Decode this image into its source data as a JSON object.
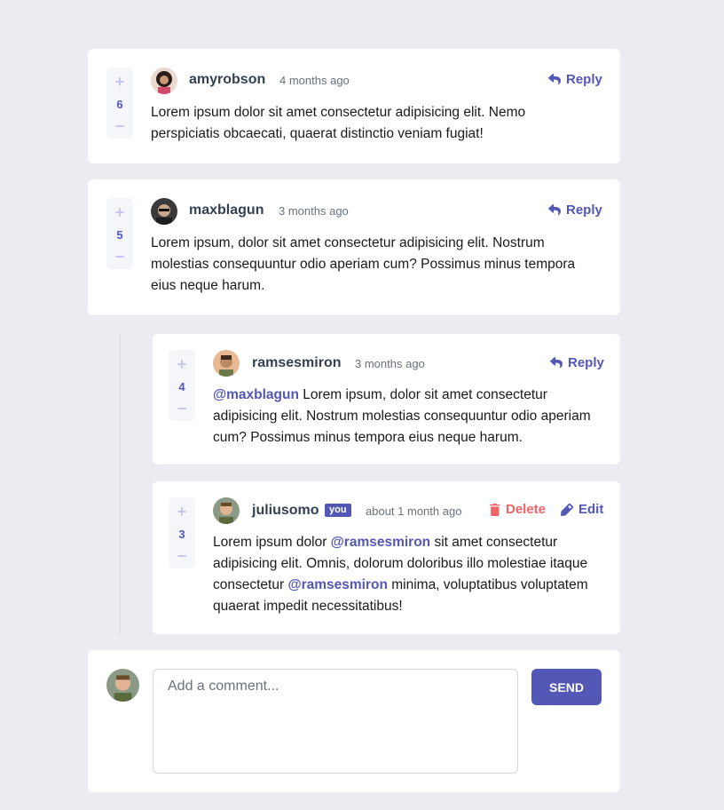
{
  "comments": [
    {
      "score": "6",
      "username": "amyrobson",
      "time": "4 months ago",
      "reply_label": "Reply",
      "content": "Lorem ipsum dolor sit amet consectetur adipisicing elit. Nemo perspiciatis obcaecati, quaerat distinctio veniam fugiat!"
    },
    {
      "score": "5",
      "username": "maxblagun",
      "time": "3 months ago",
      "reply_label": "Reply",
      "content": "Lorem ipsum, dolor sit amet consectetur adipisicing elit. Nostrum molestias consequuntur odio aperiam cum? Possimus minus tempora eius neque harum."
    }
  ],
  "replies": [
    {
      "score": "4",
      "username": "ramsesmiron",
      "time": "3 months ago",
      "reply_label": "Reply",
      "mention": "@maxblagun",
      "content": "Lorem ipsum, dolor sit amet consectetur adipisicing elit. Nostrum molestias consequuntur odio aperiam cum? Possimus minus tempora eius neque harum."
    },
    {
      "score": "3",
      "username": "juliusomo",
      "you_badge": "you",
      "time": "about 1 month ago",
      "delete_label": "Delete",
      "edit_label": "Edit",
      "content_part1": "Lorem ipsum dolor",
      "mention1": "@ramsesmiron",
      "content_part2": "sit amet consectetur adipisicing elit. Omnis, dolorum doloribus illo molestiae itaque consectetur",
      "mention2": "@ramsesmiron",
      "content_part3": "minima, voluptatibus voluptatem quaerat impedit necessitatibus!"
    }
  ],
  "compose": {
    "placeholder": "Add a comment...",
    "send_label": "SEND"
  },
  "colors": {
    "primary": "#5357b6",
    "danger": "#ed6368",
    "background": "#eaecf1",
    "text_dark": "#334253"
  }
}
